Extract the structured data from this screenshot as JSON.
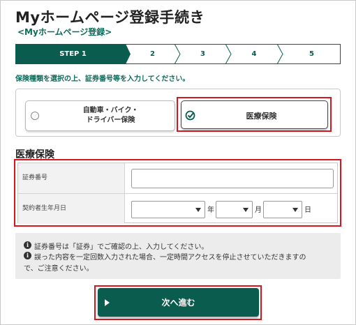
{
  "page": {
    "title": "Myホームページ登録手続き",
    "breadcrumb": "<Myホームページ登録>"
  },
  "steps": {
    "items": [
      "STEP 1",
      "2",
      "3",
      "4",
      "5"
    ],
    "active_index": 0,
    "active_color": "#0a5c4f"
  },
  "instruction": "保険種類を選択の上、証券番号等を入力してください。",
  "insurance_types": {
    "options": [
      {
        "label": "自動車・バイク・\nドライバー保険",
        "selected": false
      },
      {
        "label": "医療保険",
        "selected": true
      }
    ]
  },
  "form": {
    "section_title": "医療保険",
    "policy_number": {
      "label": "証券番号",
      "value": ""
    },
    "birthdate": {
      "label": "契約者生年月日",
      "year_unit": "年",
      "month_unit": "月",
      "day_unit": "日"
    }
  },
  "notes": [
    "証券番号は「証券」でご確認の上、入力してください。",
    "誤った内容を一定回数入力された場合、一定時間アクセスを停止させていただきますの",
    "で、ご注意ください。"
  ],
  "next_button": {
    "label": "次へ進む"
  },
  "colors": {
    "brand": "#0a5c4f",
    "highlight": "#d9141c"
  }
}
